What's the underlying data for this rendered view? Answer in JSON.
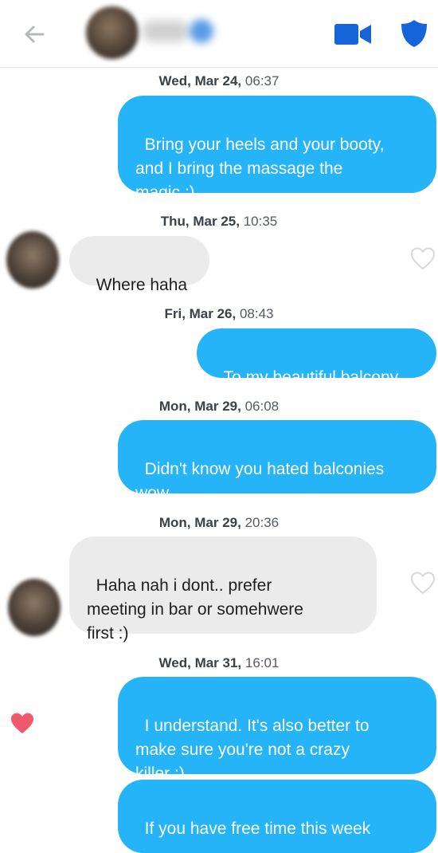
{
  "header": {
    "back_icon": "arrow-left-icon",
    "video_icon": "video-camera-icon",
    "shield_icon": "shield-icon",
    "accent_color": "#1565d8"
  },
  "messages": [
    {
      "date": "Wed, Mar 24,",
      "time": "06:37",
      "text": "Bring your heels and your booty,\nand I bring the massage the\nmagic ;)",
      "direction": "outgoing"
    },
    {
      "date": "Thu, Mar 25,",
      "time": "10:35",
      "text": "Where haha",
      "direction": "incoming"
    },
    {
      "date": "Fri, Mar 26,",
      "time": "08:43",
      "text": "To my beautiful balcony",
      "direction": "outgoing"
    },
    {
      "date": "Mon, Mar 29,",
      "time": "06:08",
      "text": "Didn't know you hated balconies\nwow",
      "direction": "outgoing"
    },
    {
      "date": "Mon, Mar 29,",
      "time": "20:36",
      "text": "Haha nah i dont.. prefer\nmeeting in bar or somehwere\nfirst :)",
      "direction": "incoming"
    },
    {
      "date": "Wed, Mar 31,",
      "time": "16:01",
      "text": "I understand. It's also better to\nmake sure you're not a crazy\nkiller ;)",
      "direction": "outgoing",
      "liked": true
    },
    {
      "text": "If you have free time this week",
      "direction": "outgoing"
    }
  ],
  "colors": {
    "outgoing_bubble": "#25b4f7",
    "incoming_bubble": "#ebebeb",
    "liked_heart": "#f0586b",
    "empty_heart": "#d8d8d8"
  }
}
